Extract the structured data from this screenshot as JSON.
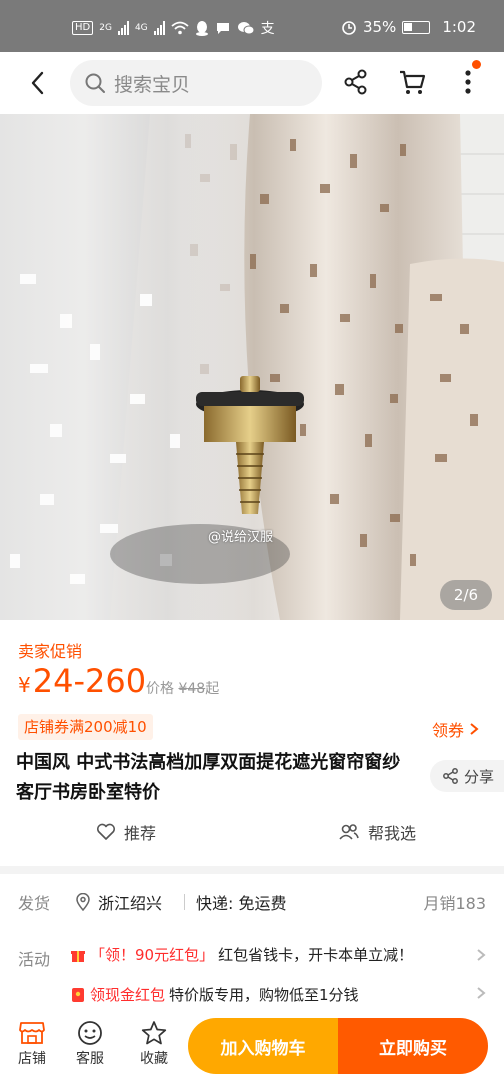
{
  "status_bar": {
    "network_chip": "HD",
    "signal_labels": [
      "2G",
      "4G"
    ],
    "battery": "35%",
    "time": "1:02",
    "icons": [
      "wifi-icon",
      "qq-icon",
      "message-icon",
      "wechat-icon",
      "alipay-icon",
      "alarm-icon",
      "battery-icon"
    ]
  },
  "header": {
    "search_placeholder": "搜索宝贝",
    "icons": [
      "back-icon",
      "search-icon",
      "share-icon",
      "cart-icon",
      "more-icon"
    ],
    "notification_color": "#ff5000"
  },
  "gallery": {
    "watermark": "@说给汉服",
    "counter": "2/6"
  },
  "price": {
    "promo_label": "卖家促销",
    "currency": "¥",
    "value": "24-260",
    "orig_prefix": "价格",
    "orig_currency": "¥",
    "orig_value": "48",
    "orig_suffix": "起",
    "coupon_text": "店铺券满200减10",
    "get_coupon": "领券",
    "accent_color": "#ff5000"
  },
  "product": {
    "title": "中国风 中式书法高档加厚双面提花遮光窗帘窗纱 客厅书房卧室特价",
    "share_label": "分享",
    "recommend_label": "推荐",
    "help_pick_label": "帮我选"
  },
  "shipping": {
    "label": "发货",
    "location": "浙江绍兴",
    "fee": "快递: 免运费",
    "monthly_sales": "月销183"
  },
  "activity": {
    "label": "活动",
    "line1_tag": "「领！90元红包」",
    "line1_text": "红包省钱卡，开卡本单立减！",
    "line2_tag": "领现金红包",
    "line2_text": "特价版专用，购物低至1分钱"
  },
  "bottom_bar": {
    "shop_label": "店铺",
    "service_label": "客服",
    "favorite_label": "收藏",
    "add_to_cart": "加入购物车",
    "buy_now": "立即购买",
    "add_color": "#ffa800",
    "buy_color": "#ff5a00"
  }
}
